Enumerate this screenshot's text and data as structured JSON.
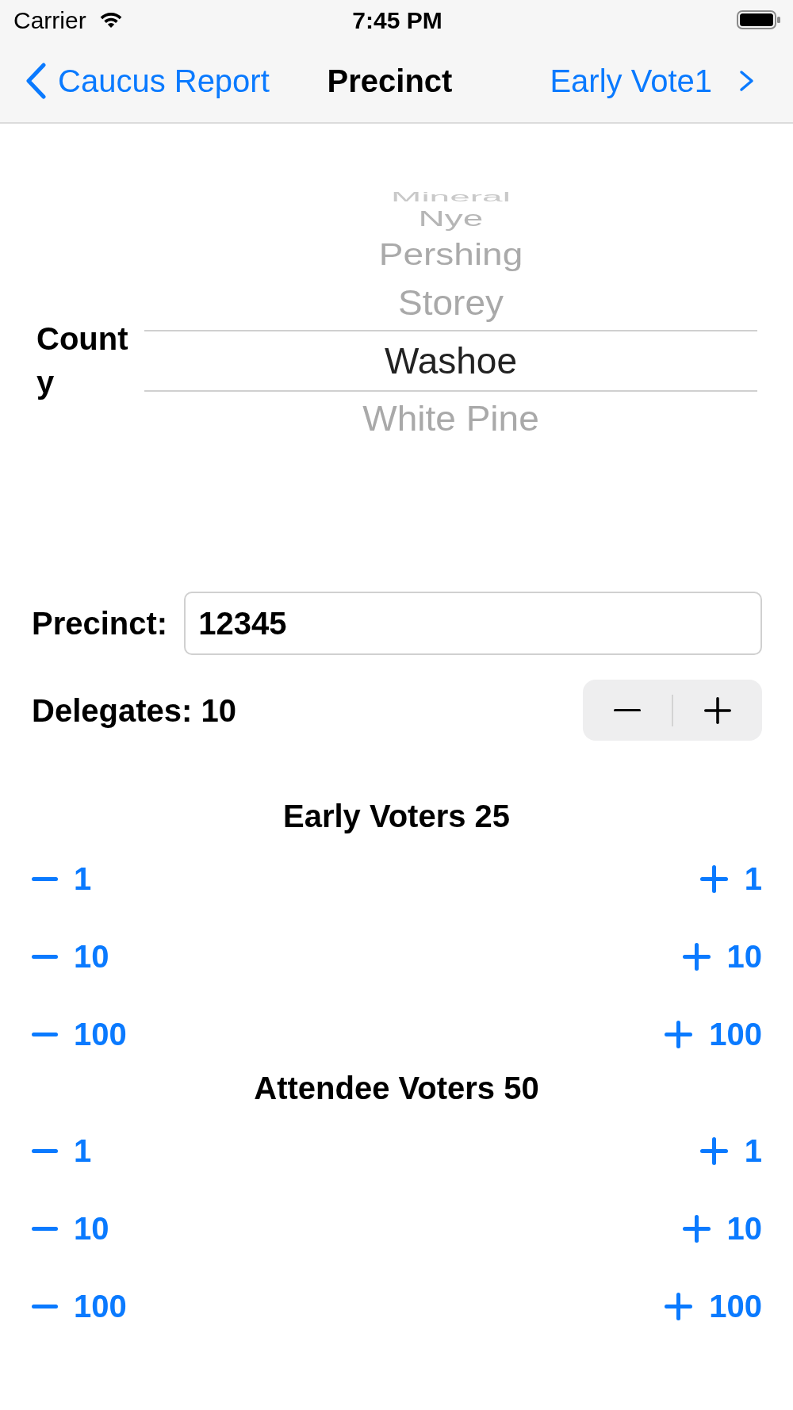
{
  "status_bar": {
    "carrier": "Carrier",
    "time": "7:45 PM"
  },
  "nav_bar": {
    "back_button": "Caucus Report",
    "title": "Precinct",
    "forward_button": "Early Vote1"
  },
  "county_picker": {
    "label": "County",
    "options": [
      {
        "label": "Mineral",
        "selected": false
      },
      {
        "label": "Nye",
        "selected": false
      },
      {
        "label": "Pershing",
        "selected": false
      },
      {
        "label": "Storey",
        "selected": false
      },
      {
        "label": "Washoe",
        "selected": true
      },
      {
        "label": "White Pine",
        "selected": false
      }
    ]
  },
  "precinct_field": {
    "label": "Precinct:",
    "value": "12345"
  },
  "delegates": {
    "label": "Delegates: 10"
  },
  "voter_counters": [
    {
      "title": "Early Voters 25",
      "rows": [
        {
          "decrement": "1",
          "increment": "1"
        },
        {
          "decrement": "10",
          "increment": "10"
        },
        {
          "decrement": "100",
          "increment": "100"
        }
      ]
    },
    {
      "title": "Attendee Voters 50",
      "rows": [
        {
          "decrement": "1",
          "increment": "1"
        },
        {
          "decrement": "10",
          "increment": "10"
        },
        {
          "decrement": "100",
          "increment": "100"
        }
      ]
    }
  ]
}
